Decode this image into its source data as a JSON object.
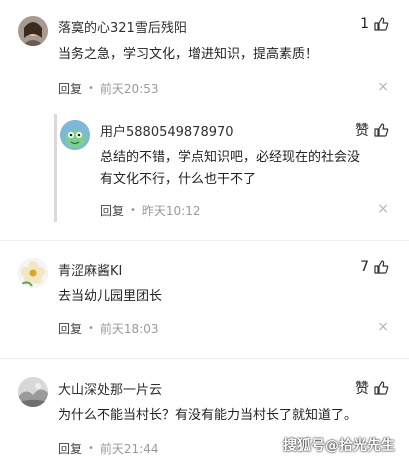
{
  "comments": [
    {
      "username": "落寞的心321雪后残阳",
      "likes": "1",
      "text": "当务之急，学习文化，增进知识，提高素质！",
      "reply_label": "回复",
      "time": "前天20:53"
    },
    {
      "username": "用户5880549878970",
      "likes": "赞",
      "text_line1": "总结的不错，学点知识吧，必经现在的社会没",
      "text_line2": "有文化不行，什么也干不了",
      "reply_label": "回复",
      "time": "昨天10:12"
    },
    {
      "username": "青涩麻酱KI",
      "likes": "7",
      "text": "去当幼儿园里团长",
      "reply_label": "回复",
      "time": "前天18:03"
    },
    {
      "username": "大山深处那一片云",
      "likes": "赞",
      "text": "为什么不能当村长？有没有能力当村长了就知道了。",
      "reply_label": "回复",
      "time": "前天21:44"
    }
  ],
  "dot": "•",
  "close_glyph": "×",
  "watermark": "搜狐号@拾光先生"
}
